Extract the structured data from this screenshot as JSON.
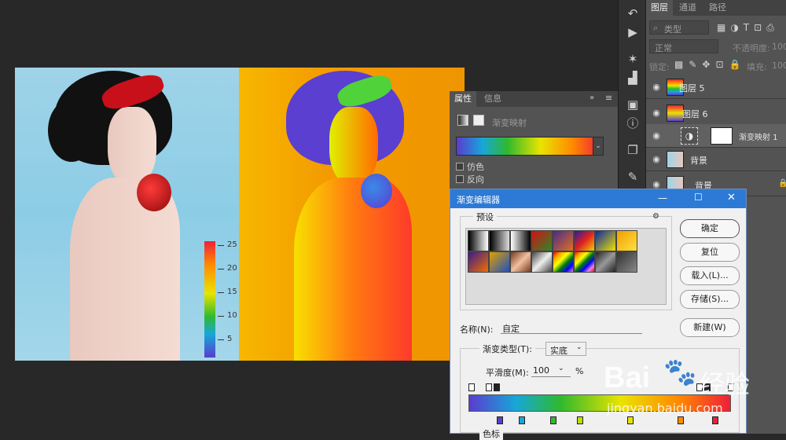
{
  "layers_panel": {
    "tabs": [
      "图层",
      "通道",
      "路径"
    ],
    "filter_placeholder": "类型",
    "blend_mode": "正常",
    "opacity_label": "不透明度:",
    "opacity_value": "100",
    "lock_label": "锁定:",
    "fill_label": "填充:",
    "fill_value": "100",
    "layers": [
      {
        "name": "图层 5"
      },
      {
        "name": "图层 6"
      },
      {
        "name": "渐变映射 1"
      },
      {
        "name": "背景"
      },
      {
        "name": "背景"
      }
    ]
  },
  "properties_panel": {
    "tabs": [
      "属性",
      "信息"
    ],
    "type_label": "渐变映射",
    "dither_label": "仿色",
    "reverse_label": "反向"
  },
  "dialog": {
    "title": "渐变编辑器",
    "presets_label": "预设",
    "ok": "确定",
    "reset": "复位",
    "load": "载入(L)...",
    "save": "存储(S)...",
    "name_label": "名称(N):",
    "name_value": "自定",
    "new_button": "新建(W)",
    "type_label": "渐变类型(T):",
    "type_value": "实底",
    "smooth_label": "平滑度(M):",
    "smooth_value": "100",
    "percent": "%",
    "stops_label": "色标",
    "presets": [
      "linear-gradient(90deg,#000,#fff)",
      "linear-gradient(90deg,#000,rgba(0,0,0,0))",
      "linear-gradient(90deg,#fff,#000)",
      "linear-gradient(135deg,#d41010,#2a8a2a)",
      "linear-gradient(135deg,#4a2a8a,#e07020)",
      "linear-gradient(135deg,#2020a0,#e02020,#f0d000)",
      "linear-gradient(135deg,#0a2aa0,#f0e000)",
      "linear-gradient(135deg,#f0a000,#ffe040)",
      "linear-gradient(135deg,#3a1a8a,#f07000)",
      "linear-gradient(135deg,#e0a000,#2050c0)",
      "linear-gradient(135deg,#7a3a1a,#f0c0a0,#7a3a1a)",
      "linear-gradient(135deg,#444,#eee,#444)",
      "linear-gradient(135deg,red,orange,yellow,green,blue,violet)",
      "linear-gradient(135deg,red,orange,yellow,green,blue,violet,red)",
      "linear-gradient(135deg,#222,#999,#222)",
      "linear-gradient(135deg,#333,#888)"
    ]
  },
  "heat_legend": {
    "labels": [
      "25",
      "20",
      "15",
      "10",
      "5"
    ]
  },
  "watermark": {
    "brand": "Bai",
    "brand_cn": "经验",
    "url": "jingyan.baidu.com"
  }
}
